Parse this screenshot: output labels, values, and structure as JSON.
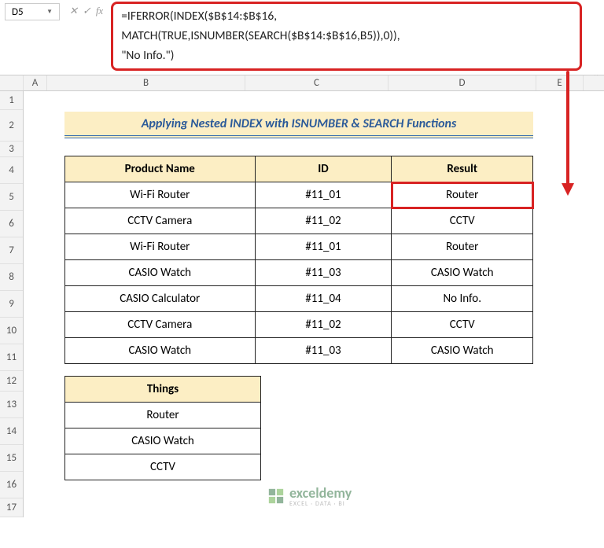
{
  "namebox": {
    "value": "D5"
  },
  "formula_bar": {
    "line1": "=IFERROR(INDEX($B$14:$B$16,",
    "line2": "MATCH(TRUE,ISNUMBER(SEARCH($B$14:$B$16,B5)),0)),",
    "line3": "\"No Info.\")"
  },
  "column_headers": [
    "",
    "A",
    "B",
    "C",
    "D",
    "E"
  ],
  "row_headers": [
    "1",
    "2",
    "3",
    "4",
    "5",
    "6",
    "7",
    "8",
    "9",
    "10",
    "11",
    "12",
    "13",
    "14",
    "15",
    "16",
    "17"
  ],
  "title_banner": "Applying Nested INDEX with ISNUMBER & SEARCH Functions",
  "main_table": {
    "headers": [
      "Product Name",
      "ID",
      "Result"
    ],
    "rows": [
      {
        "product": "Wi-Fi Router",
        "id": "#11_01",
        "result": "Router",
        "highlight": true
      },
      {
        "product": "CCTV Camera",
        "id": "#11_02",
        "result": "CCTV"
      },
      {
        "product": "Wi-Fi Router",
        "id": "#11_01",
        "result": "Router"
      },
      {
        "product": "CASIO Watch",
        "id": "#11_03",
        "result": "CASIO Watch"
      },
      {
        "product": "CASIO Calculator",
        "id": "#11_04",
        "result": "No Info."
      },
      {
        "product": "CCTV Camera",
        "id": "#11_02",
        "result": "CCTV"
      },
      {
        "product": "CASIO Watch",
        "id": "#11_03",
        "result": "CASIO Watch"
      }
    ]
  },
  "things_table": {
    "header": "Things",
    "rows": [
      "Router",
      "CASIO Watch",
      "CCTV"
    ]
  },
  "watermark": {
    "brand": "exceldemy",
    "tagline": "EXCEL · DATA · BI"
  },
  "fx_label": "fx"
}
